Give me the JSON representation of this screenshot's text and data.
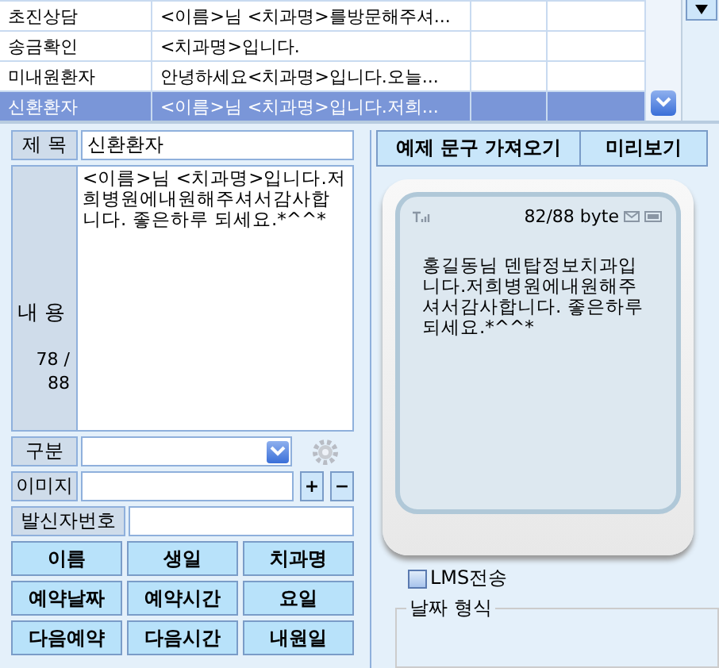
{
  "templates": [
    {
      "name": "초진상담",
      "text": "<이름>님 <치과명>를방문해주셔...",
      "selected": false
    },
    {
      "name": "송금확인",
      "text": "<치과명>입니다.",
      "selected": false
    },
    {
      "name": "미내원환자",
      "text": "안녕하세요<치과명>입니다.오늘...",
      "selected": false
    },
    {
      "name": "신환환자",
      "text": "<이름>님 <치과명>입니다.저희...",
      "selected": true
    }
  ],
  "form": {
    "subject_label": "제 목",
    "subject": "신환환자",
    "content_label": "내 용",
    "count": "78 /",
    "limit": "88",
    "content": "<이름>님 <치과명>입니다.저희병원에내원해주셔서감사합니다. 좋은하루 되세요.*^^*",
    "category_label": "구분",
    "image_label": "이미지",
    "plus": "+",
    "minus": "−",
    "sender_label": "발신자번호"
  },
  "insert_buttons": [
    "이름",
    "생일",
    "치과명",
    "예약날짜",
    "예약시간",
    "요일",
    "다음예약",
    "다음시간",
    "내원일"
  ],
  "tabs": [
    "예제 문구 가져오기",
    "미리보기"
  ],
  "phone": {
    "bytes": "82/88 byte",
    "message": "홍길동님 덴탑정보치과입니다.저희병원에내원해주셔서감사합니다. 좋은하루 되세요.*^^*"
  },
  "lms": {
    "label": "LMS전송",
    "checked": false
  },
  "date_format": {
    "label": "날짜 형식"
  }
}
